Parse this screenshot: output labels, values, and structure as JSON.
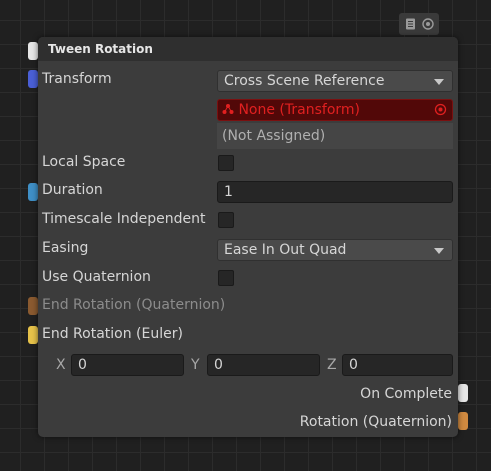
{
  "node": {
    "title": "Tween Rotation",
    "fields": {
      "transform_label": "Transform",
      "transform_dropdown": "Cross Scene Reference",
      "transform_value": "None (Transform)",
      "transform_status": "(Not Assigned)",
      "local_space_label": "Local Space",
      "duration_label": "Duration",
      "duration_value": "1",
      "timescale_label": "Timescale Independent",
      "easing_label": "Easing",
      "easing_value": "Ease In Out Quad",
      "use_quaternion_label": "Use Quaternion",
      "end_rotation_quat_label": "End Rotation (Quaternion)",
      "end_rotation_euler_label": "End Rotation (Euler)",
      "x_label": "X",
      "x_value": "0",
      "y_label": "Y",
      "y_value": "0",
      "z_label": "Z",
      "z_value": "0"
    },
    "outputs": {
      "on_complete": "On Complete",
      "rotation": "Rotation (Quaternion)"
    }
  },
  "toolbar": {
    "icons": [
      "document-icon",
      "target-icon"
    ]
  },
  "colors": {
    "node_bg": "#3c3c3c",
    "error_red": "#e02020",
    "port_white": "#e6e6e6",
    "port_blue": "#4a5fd6",
    "port_cyan": "#3f8fc6",
    "port_brown": "#8a5a30",
    "port_yellow": "#e6c24a",
    "port_orange": "#d08a40"
  }
}
